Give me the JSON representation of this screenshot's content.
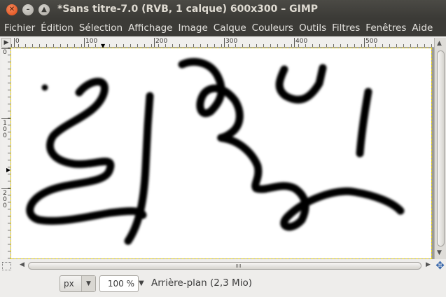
{
  "window": {
    "title": "*Sans titre-7.0 (RVB, 1 calque) 600x300 – GIMP",
    "close_glyph": "✕",
    "minimize_glyph": "–",
    "maximize_glyph": "▲"
  },
  "menu": [
    "Fichier",
    "Édition",
    "Sélection",
    "Affichage",
    "Image",
    "Calque",
    "Couleurs",
    "Outils",
    "Filtres",
    "Fenêtres",
    "Aide"
  ],
  "ruler": {
    "h_labels": [
      "0",
      "100",
      "200",
      "300",
      "400",
      "500"
    ],
    "v_labels": [
      "0",
      "100",
      "200"
    ],
    "corner_glyph": "▶"
  },
  "statusbar": {
    "unit": "px",
    "zoom": "100 %",
    "message": "Arrière-plan (2,3 Mio)"
  },
  "icons": {
    "navigate": "✥",
    "dropdown": "▼"
  },
  "colors": {
    "titlebar": "#3c3b37",
    "close_button": "#e5571c",
    "selection_marquee": "#e8d000",
    "stroke": "#000000"
  }
}
